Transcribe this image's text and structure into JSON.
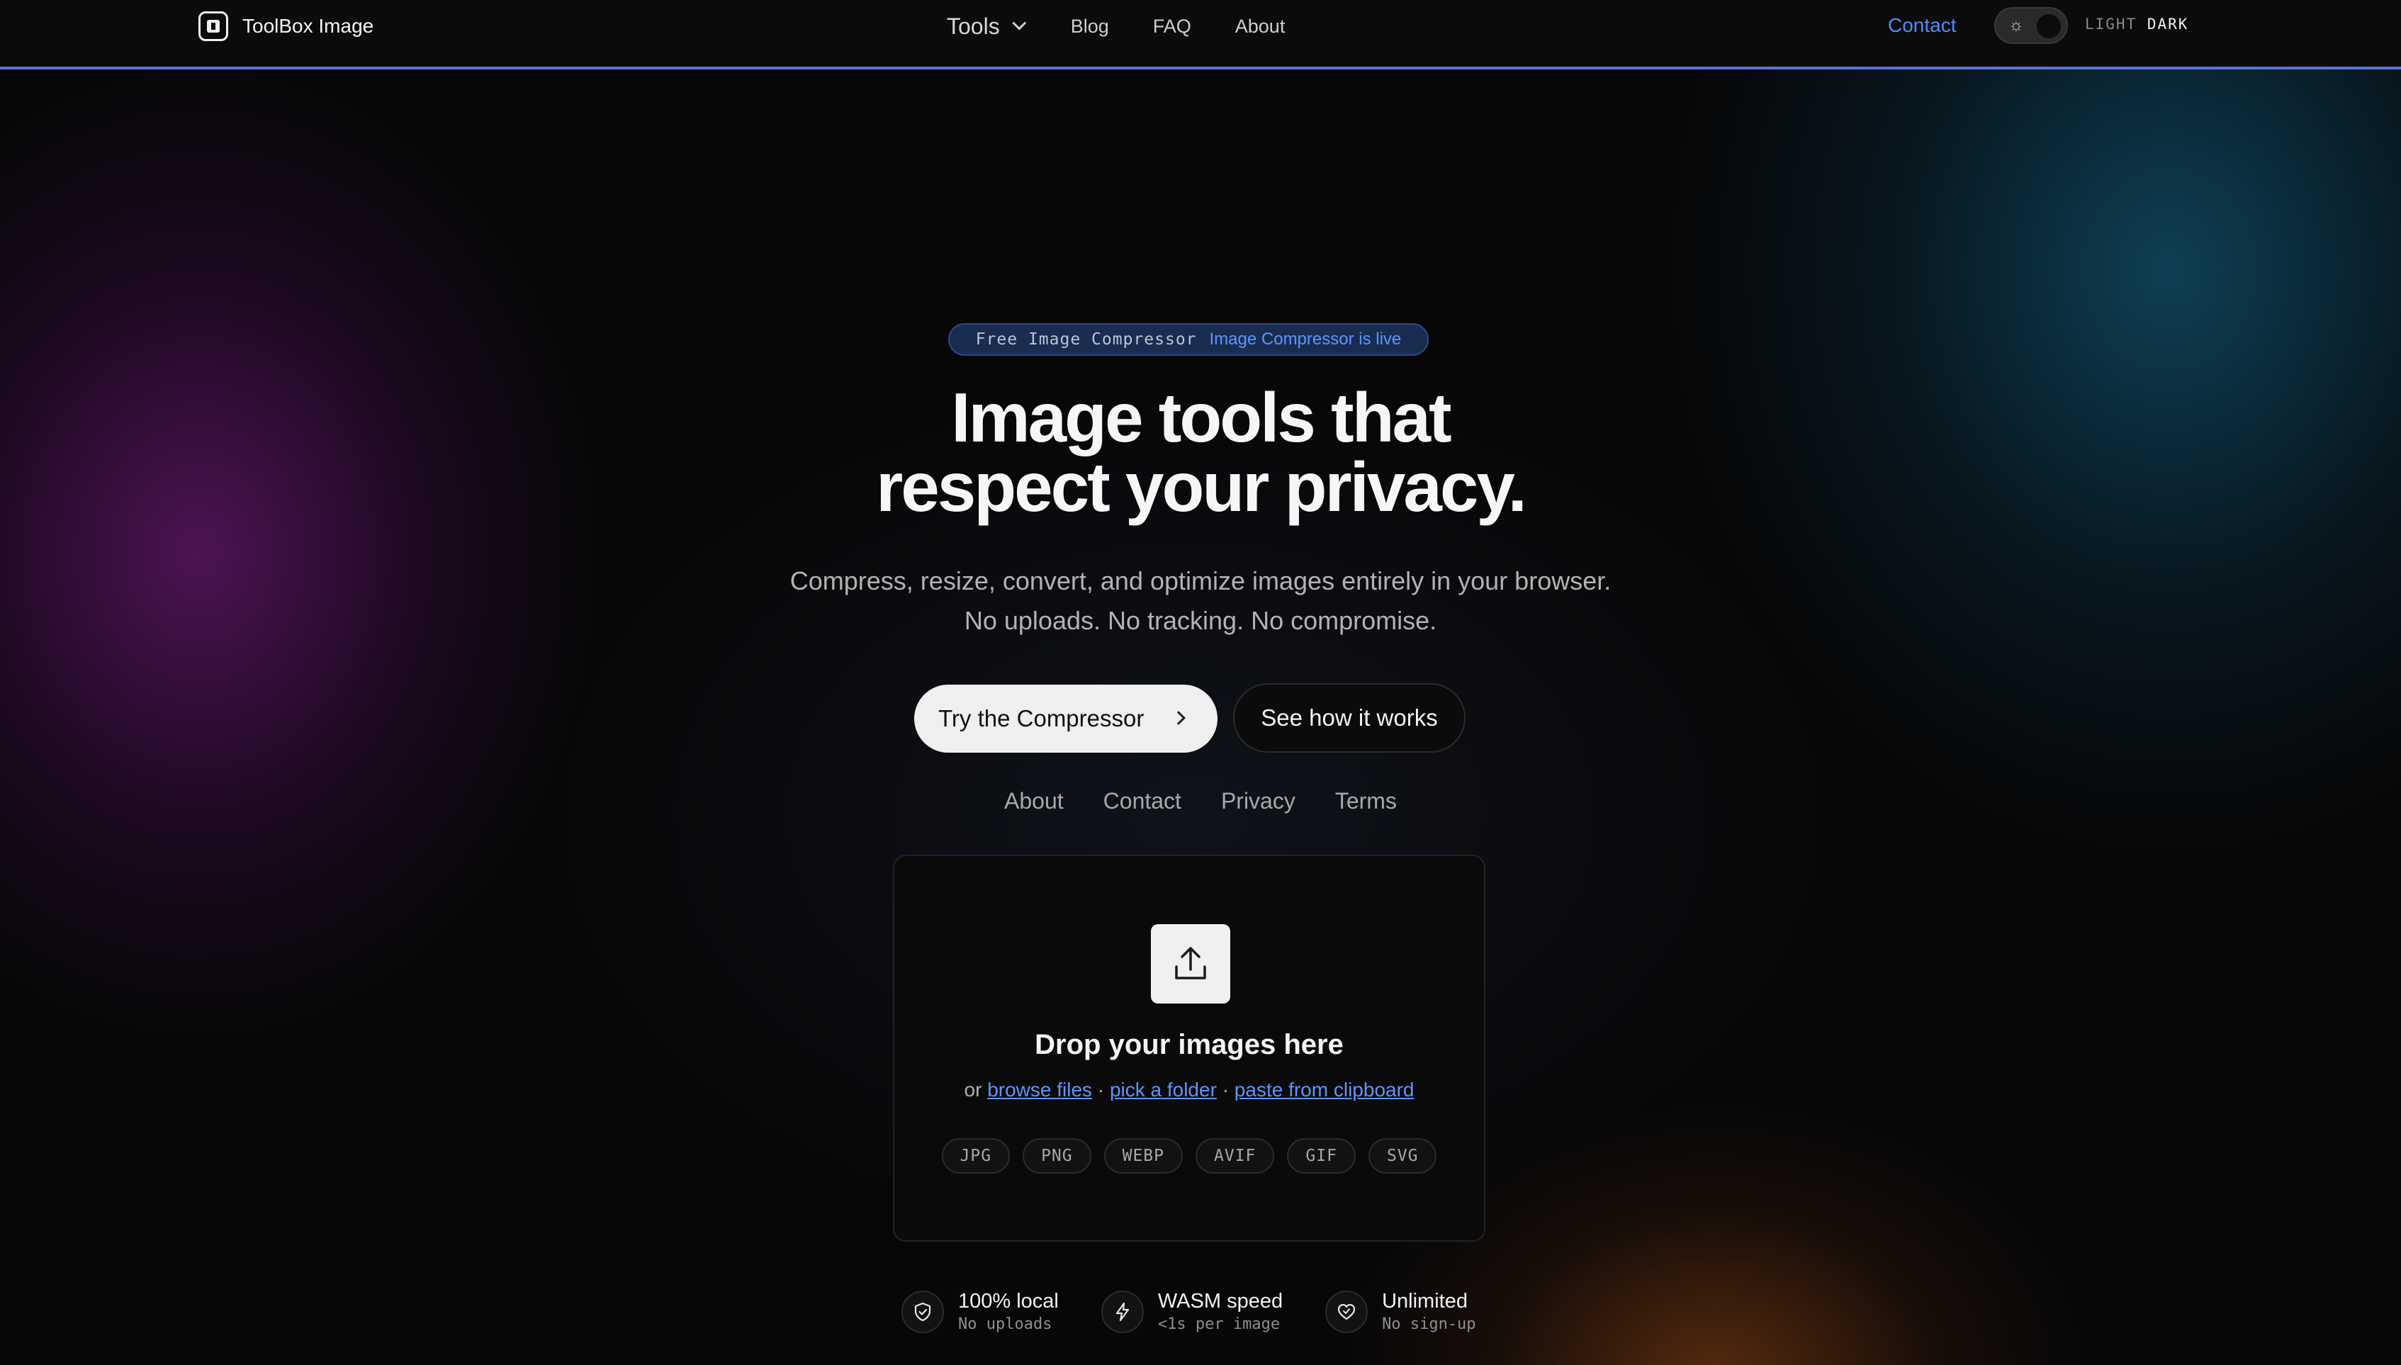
{
  "nav": {
    "brand": "ToolBox Image",
    "tools_label": "Tools",
    "blog_label": "Blog",
    "faq_label": "FAQ",
    "about_label": "About",
    "contact_label": "Contact",
    "mode_light": "LIGHT",
    "mode_dark": "DARK",
    "theme": "dark"
  },
  "hero": {
    "pill_mono": "Free Image Compressor",
    "pill_text": "Image Compressor is live",
    "headline_line1": "Image tools that",
    "headline_line2": "respect your privacy.",
    "sub_line1": "Compress, resize, convert, and optimize images entirely in your browser.",
    "sub_line2": "No uploads. No tracking. No compromise.",
    "primary_cta": "Try the Compressor",
    "secondary_cta": "See how it works"
  },
  "links": [
    "About",
    "Contact",
    "Privacy",
    "Terms"
  ],
  "dropzone": {
    "title": "Drop your images here",
    "prefix": "or",
    "browse": "browse files",
    "folder": "pick a folder",
    "paste": "paste from clipboard",
    "separator": "·",
    "formats": [
      "JPG",
      "PNG",
      "WEBP",
      "AVIF",
      "GIF",
      "SVG"
    ]
  },
  "features": [
    {
      "title": "100% local",
      "sub": "No uploads",
      "icon": "shield-icon"
    },
    {
      "title": "WASM speed",
      "sub": "<1s per image",
      "icon": "bolt-icon"
    },
    {
      "title": "Unlimited",
      "sub": "No sign-up",
      "icon": "heart-icon"
    }
  ],
  "colors": {
    "accent": "#4f8dff",
    "nav_border": "#5b73d6"
  }
}
